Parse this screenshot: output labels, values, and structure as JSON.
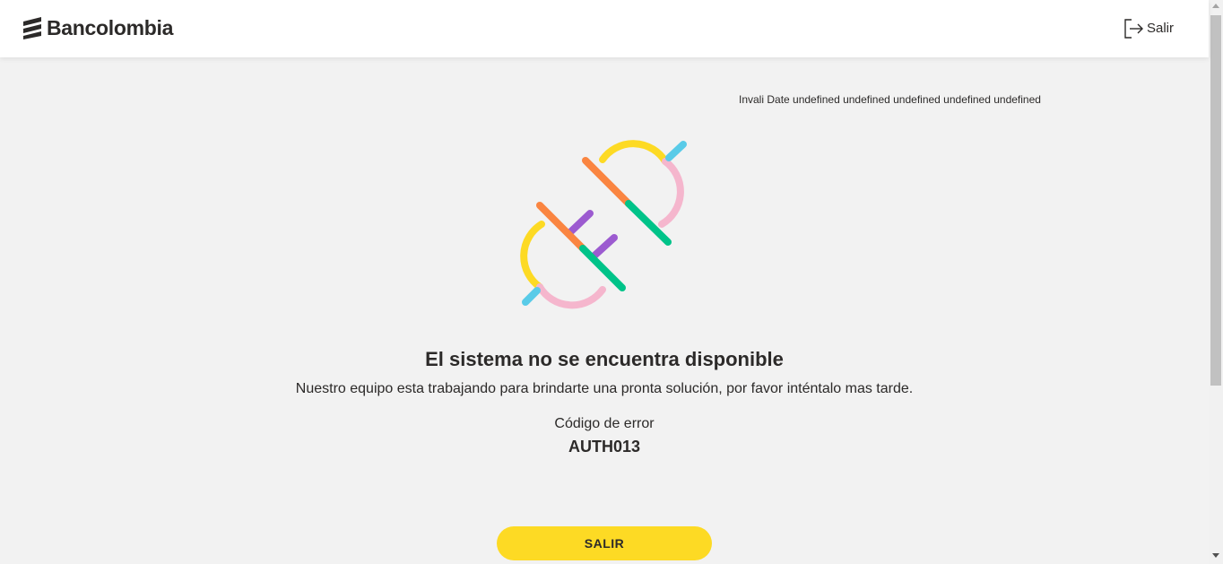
{
  "header": {
    "brand_name": "Bancolombia",
    "exit_label": "Salir"
  },
  "main": {
    "date_text": "Invali Date undefined undefined undefined undefined undefined",
    "title": "El sistema no se encuentra disponible",
    "subtitle": "Nuestro equipo esta trabajando para brindarte una pronta solución, por favor inténtalo mas tarde.",
    "error_label": "Código de error",
    "error_code": "AUTH013",
    "exit_button_label": "SALIR"
  },
  "icons": {
    "logo": "bancolombia-logo-icon",
    "exit": "exit-door-icon",
    "illustration": "disconnected-plug-icon"
  },
  "colors": {
    "accent_yellow": "#fdda24",
    "text": "#2c2a29",
    "background": "#f2f2f2",
    "plug_orange": "#fa8541",
    "plug_green": "#00c389",
    "plug_purple": "#9c5bd0",
    "plug_pink": "#f5b6cd",
    "plug_blue": "#59cbe8"
  }
}
